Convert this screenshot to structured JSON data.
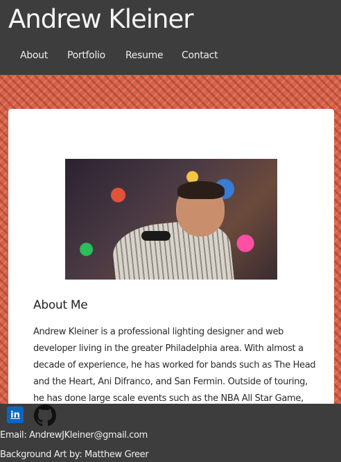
{
  "header": {
    "title": "Andrew Kleiner",
    "nav": [
      "About",
      "Portfolio",
      "Resume",
      "Contact"
    ]
  },
  "about": {
    "heading": "About Me",
    "body": "Andrew Kleiner is a professional lighting designer and web developer living in the greater Philadelphia area. With almost a decade of experience, he has worked for bands such as The Head and the Heart, Ani Difranco, and San Fermin. Outside of touring, he has done large scale events such as the NBA All Star Game, and the"
  },
  "footer": {
    "icons": [
      "linkedin-icon",
      "github-icon"
    ],
    "linkedin_glyph": "in",
    "email": "Email: AndrewJKleiner@gmail.com",
    "credit": "Background Art by: Matthew Greer"
  },
  "colors": {
    "header_bg": "#3d3d3d",
    "pattern": "#d9624a",
    "card": "#ffffff",
    "linkedin": "#0a66c2"
  }
}
